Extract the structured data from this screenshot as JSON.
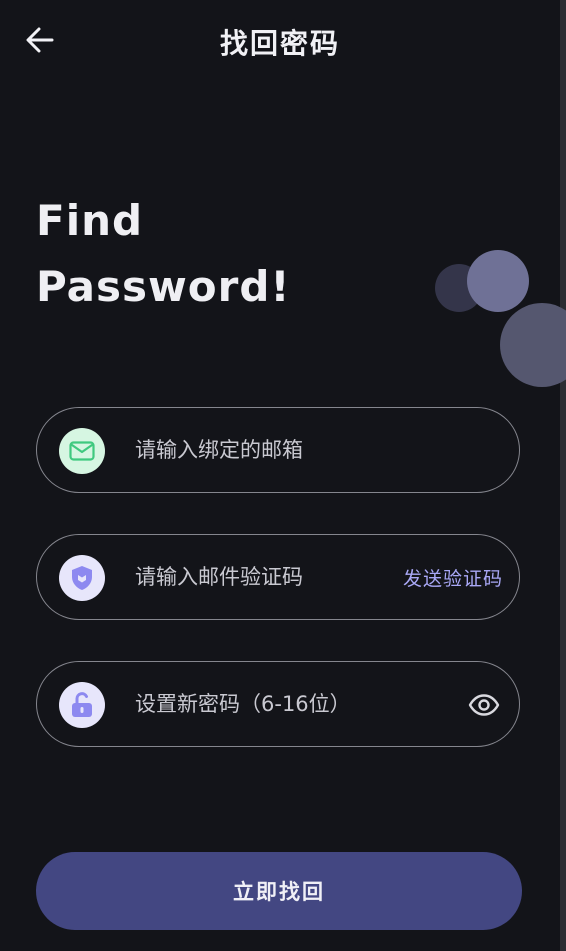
{
  "header": {
    "title": "找回密码",
    "back_icon": "arrow-left-icon"
  },
  "hero": {
    "line1": "Find",
    "line2": "Password!"
  },
  "form": {
    "email": {
      "icon": "mail-icon",
      "placeholder": "请输入绑定的邮箱",
      "value": ""
    },
    "code": {
      "icon": "shield-icon",
      "placeholder": "请输入邮件验证码",
      "value": "",
      "send_label": "发送验证码"
    },
    "password": {
      "icon": "unlock-icon",
      "placeholder": "设置新密码（6-16位）",
      "value": "",
      "toggle_icon": "eye-icon"
    }
  },
  "submit": {
    "label": "立即找回"
  },
  "colors": {
    "background": "#131419",
    "accent": "#434782",
    "link": "#a9a8f6",
    "mail_icon_bg": "#d6f6e2",
    "mail_icon_fg": "#3fc97f",
    "lock_icon_bg": "#e7e6fb",
    "lock_icon_fg": "#8d89f0"
  }
}
